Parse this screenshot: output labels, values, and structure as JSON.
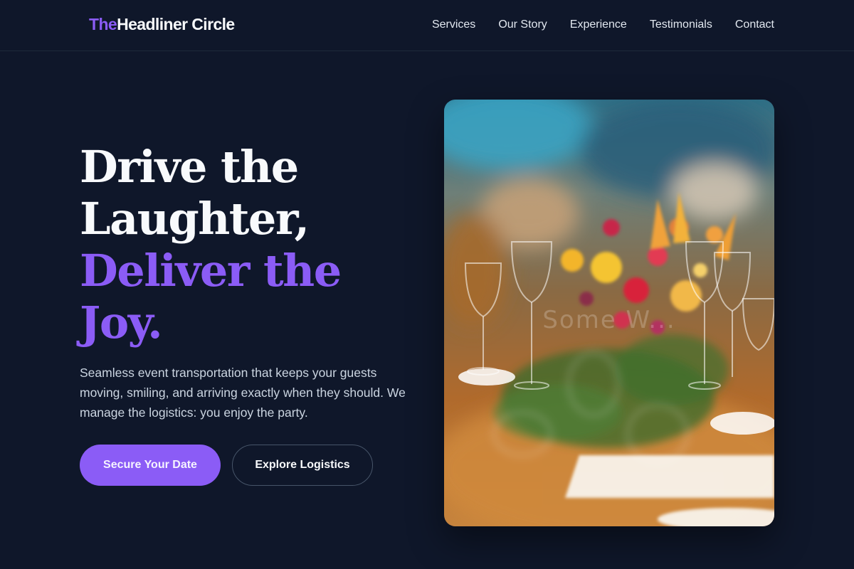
{
  "brand": {
    "name_accent": "The",
    "name_rest": "Headliner Circle"
  },
  "nav": {
    "links": [
      {
        "label": "Services"
      },
      {
        "label": "Our Story"
      },
      {
        "label": "Experience"
      },
      {
        "label": "Testimonials"
      },
      {
        "label": "Contact"
      }
    ]
  },
  "hero": {
    "title_lines": [
      "Drive the",
      "Laughter,"
    ],
    "title_accent_lines": [
      "Deliver the",
      "Joy."
    ],
    "subtitle": "Seamless event transportation that keeps your guests moving, smiling, and arriving exactly when they should. We manage the logistics: you enjoy the party.",
    "primary_cta": "Secure Your Date",
    "secondary_cta": "Explore Logistics",
    "image_watermark": "Some W..."
  },
  "colors": {
    "background": "#0f172a",
    "accent": "#8b5cf6",
    "text": "#f8fafc",
    "muted_text": "#cbd5e1"
  },
  "icons": {
    "hero_image": "event-table-floral-photo"
  }
}
